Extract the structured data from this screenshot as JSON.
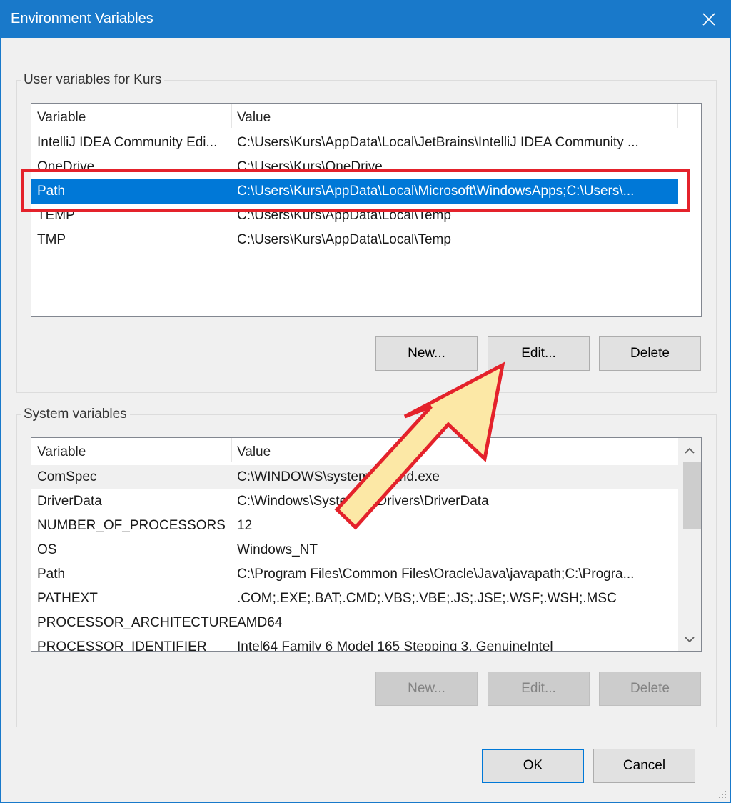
{
  "window": {
    "title": "Environment Variables",
    "close_icon": "close-icon"
  },
  "user_group": {
    "label": "User variables for Kurs",
    "columns": [
      "Variable",
      "Value"
    ],
    "rows": [
      {
        "variable": "IntelliJ IDEA Community Edi...",
        "value": "C:\\Users\\Kurs\\AppData\\Local\\JetBrains\\IntelliJ IDEA Community ..."
      },
      {
        "variable": "OneDrive",
        "value": "C:\\Users\\Kurs\\OneDrive"
      },
      {
        "variable": "Path",
        "value": "C:\\Users\\Kurs\\AppData\\Local\\Microsoft\\WindowsApps;C:\\Users\\..."
      },
      {
        "variable": "TEMP",
        "value": "C:\\Users\\Kurs\\AppData\\Local\\Temp"
      },
      {
        "variable": "TMP",
        "value": "C:\\Users\\Kurs\\AppData\\Local\\Temp"
      }
    ],
    "selected_index": 2,
    "buttons": {
      "new": "New...",
      "edit": "Edit...",
      "delete": "Delete"
    }
  },
  "system_group": {
    "label": "System variables",
    "columns": [
      "Variable",
      "Value"
    ],
    "rows": [
      {
        "variable": "ComSpec",
        "value": "C:\\WINDOWS\\system32\\cmd.exe"
      },
      {
        "variable": "DriverData",
        "value": "C:\\Windows\\System32\\Drivers\\DriverData"
      },
      {
        "variable": "NUMBER_OF_PROCESSORS",
        "value": "12"
      },
      {
        "variable": "OS",
        "value": "Windows_NT"
      },
      {
        "variable": "Path",
        "value": "C:\\Program Files\\Common Files\\Oracle\\Java\\javapath;C:\\Progra..."
      },
      {
        "variable": "PATHEXT",
        "value": ".COM;.EXE;.BAT;.CMD;.VBS;.VBE;.JS;.JSE;.WSF;.WSH;.MSC"
      },
      {
        "variable": "PROCESSOR_ARCHITECTURE",
        "value": "AMD64"
      },
      {
        "variable": "PROCESSOR_IDENTIFIER",
        "value": "Intel64 Family 6 Model 165 Stepping 3, GenuineIntel"
      }
    ],
    "buttons": {
      "new": "New...",
      "edit": "Edit...",
      "delete": "Delete"
    }
  },
  "footer": {
    "ok": "OK",
    "cancel": "Cancel"
  },
  "colors": {
    "titlebar": "#1979ca",
    "selection": "#0078d7",
    "annotation_red": "#e4222b",
    "arrow_fill": "#fce8a6"
  },
  "annotations": {
    "highlight": "red-box-around-path-row",
    "arrow": "arrow-pointing-to-edit-button"
  }
}
